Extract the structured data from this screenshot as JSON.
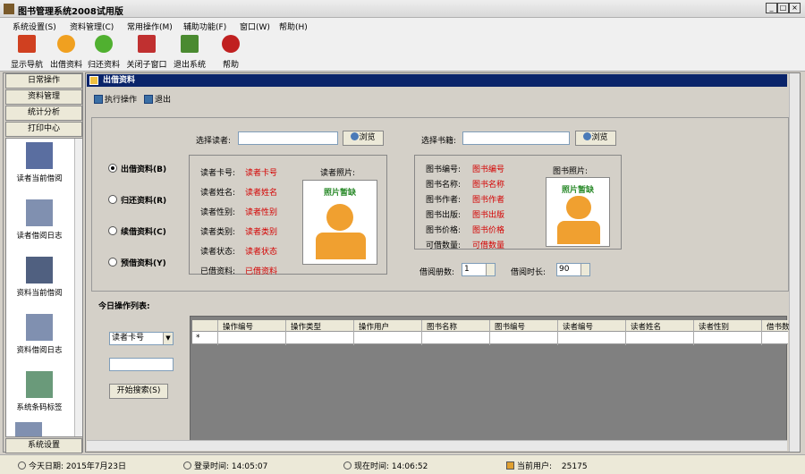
{
  "window": {
    "title": "图书管理系统2008试用版",
    "controls": [
      "_",
      "□",
      "×"
    ]
  },
  "menu": [
    "系统设置(S)",
    "资料管理(C)",
    "常用操作(M)",
    "辅助功能(F)",
    "窗口(W)",
    "帮助(H)"
  ],
  "toolbar": [
    {
      "label": "显示导航",
      "icon": "home-icon",
      "color": "#d04020"
    },
    {
      "label": "出借资料",
      "icon": "minus-circle-icon",
      "color": "#f0a020"
    },
    {
      "label": "归还资料",
      "icon": "plus-circle-icon",
      "color": "#50b030"
    },
    {
      "label": "关闭子窗口",
      "icon": "close-window-icon",
      "color": "#c03030"
    },
    {
      "label": "退出系统",
      "icon": "exit-icon",
      "color": "#4a8a30"
    },
    {
      "label": "帮助",
      "icon": "help-icon",
      "color": "#c02020"
    }
  ],
  "nav": {
    "sections": [
      "日常操作",
      "资料管理",
      "统计分析",
      "打印中心"
    ],
    "items": [
      {
        "label": "读者当前借阅",
        "icon": "reader-borrow-icon"
      },
      {
        "label": "读者借阅日志",
        "icon": "reader-log-icon"
      },
      {
        "label": "资料当前借阅",
        "icon": "book-borrow-icon"
      },
      {
        "label": "资料借阅日志",
        "icon": "book-log-icon"
      },
      {
        "label": "系统条码标签",
        "icon": "barcode-label-icon"
      }
    ],
    "bottom": "系统设置"
  },
  "subwindow": {
    "title": "出借资料",
    "actions": [
      {
        "label": "执行操作",
        "icon": "execute-icon"
      },
      {
        "label": "退出",
        "icon": "exit-icon"
      }
    ]
  },
  "form": {
    "select_reader_label": "选择读者:",
    "select_book_label": "选择书籍:",
    "browse": "浏览",
    "reader_input": "",
    "book_input": "",
    "operations": [
      {
        "label": "出借资料(B)",
        "selected": true
      },
      {
        "label": "归还资料(R)",
        "selected": false
      },
      {
        "label": "续借资料(C)",
        "selected": false
      },
      {
        "label": "预借资料(Y)",
        "selected": false
      }
    ],
    "reader_fields": [
      {
        "label": "读者卡号:",
        "value": "读者卡号"
      },
      {
        "label": "读者姓名:",
        "value": "读者姓名"
      },
      {
        "label": "读者性别:",
        "value": "读者性别"
      },
      {
        "label": "读者类别:",
        "value": "读者类别"
      },
      {
        "label": "读者状态:",
        "value": "读者状态"
      },
      {
        "label": "已借资料:",
        "value": "已借资料"
      }
    ],
    "reader_photo_label": "读者照片:",
    "book_fields": [
      {
        "label": "图书编号:",
        "value": "图书编号"
      },
      {
        "label": "图书名称:",
        "value": "图书名称"
      },
      {
        "label": "图书作者:",
        "value": "图书作者"
      },
      {
        "label": "图书出版:",
        "value": "图书出版"
      },
      {
        "label": "图书价格:",
        "value": "图书价格"
      },
      {
        "label": "可借数量:",
        "value": "可借数量"
      }
    ],
    "book_photo_label": "图书照片:",
    "photo_placeholder": "照片暂缺",
    "borrow_count_label": "借阅册数:",
    "borrow_count": "1",
    "borrow_period_label": "借阅时长:",
    "borrow_period": "90"
  },
  "today_list": {
    "label": "今日操作列表:",
    "search_field": "读者卡号",
    "search_value": "",
    "search_button": "开始搜索(S)",
    "columns": [
      "操作编号",
      "操作类型",
      "操作用户",
      "图书名称",
      "图书编号",
      "读者编号",
      "读者姓名",
      "读者性别",
      "借书数"
    ],
    "new_row_marker": "*"
  },
  "status": {
    "date": "今天日期: 2015年7月23日",
    "login": "登录时间: 14:05:07",
    "now": "现在时间: 14:06:52",
    "user_label": "当前用户:",
    "user": "25175"
  }
}
